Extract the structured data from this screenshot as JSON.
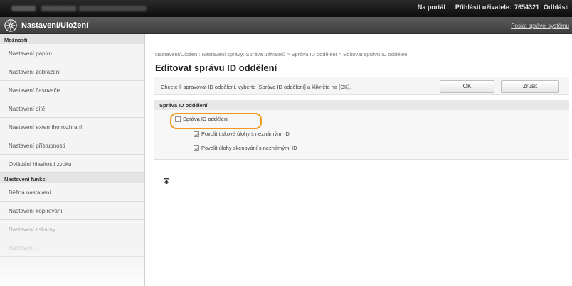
{
  "topbar": {
    "portal_link": "Na portál",
    "login_label": "Přihlásit uživatele:",
    "user_id": "7654321",
    "logout": "Odhlásit"
  },
  "header": {
    "icon": "gear-icon",
    "title": "Nastavení/Uložení",
    "mail_admin": "Poslat správci systému"
  },
  "sidebar": {
    "sections": [
      {
        "label": "Možnosti",
        "items": [
          "Nastavení papíru",
          "Nastavení zobrazení",
          "Nastavení časovače",
          "Nastavení sítě",
          "Nastavení externího rozhraní",
          "Nastavení přístupnosti",
          "Ovládání hlasitosti zvuku"
        ]
      },
      {
        "label": "Nastavení funkcí",
        "items": [
          "Běžná nastavení",
          "Nastavení kopírování",
          "Nastavení tiskárny",
          "Nastavení ..."
        ]
      }
    ]
  },
  "main": {
    "breadcrumb": "Nastavení/Uložení: Nastavení správy: Správa uživatelů > Správa ID oddělení > Editovat správu ID oddělení",
    "title": "Editovat správu ID oddělení",
    "instruction": "Chcete-li spravovat ID oddělení, vyberte [Správa ID oddělení] a klikněte na [OK].",
    "ok_label": "OK",
    "cancel_label": "Zrušit",
    "section_title": "Správa ID oddělení",
    "options": [
      {
        "label": "Správa ID oddělení",
        "checked": false
      },
      {
        "label": "Povolit tiskové úlohy s neznámými ID",
        "checked": true
      },
      {
        "label": "Povolit úlohy skenování s neznámými ID",
        "checked": true
      }
    ],
    "highlight_color": "#f29a1d",
    "collapse_icon": "collapse-top-icon"
  }
}
